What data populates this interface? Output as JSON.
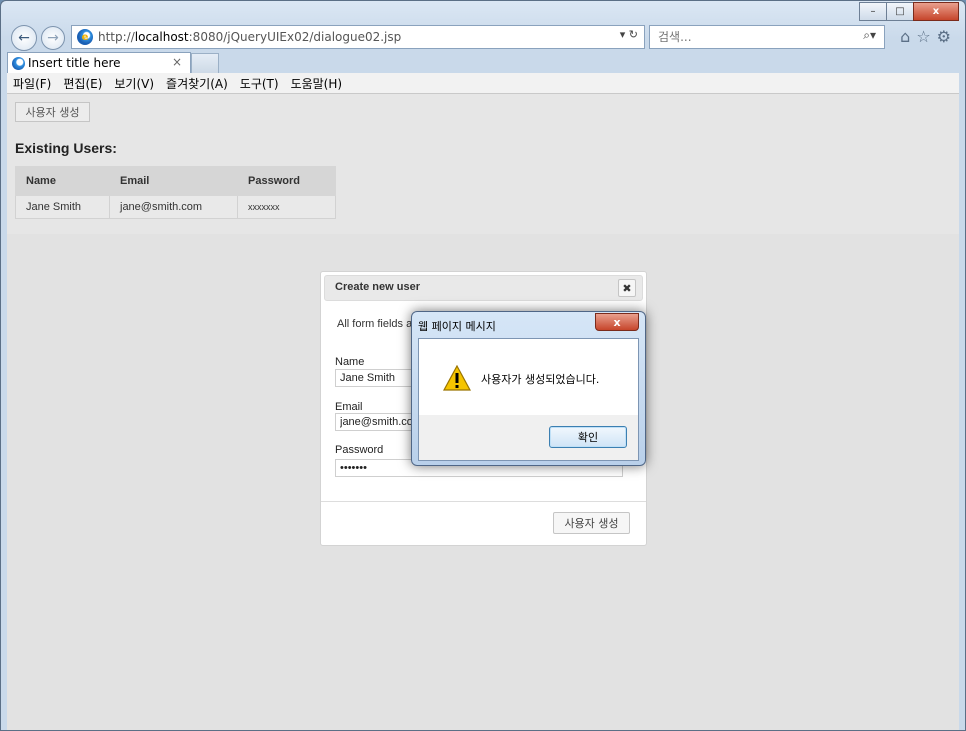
{
  "browser": {
    "url_prefix": "http://",
    "url_host": "localhost",
    "url_rest": ":8080/jQueryUIEx02/dialogue02.jsp",
    "url_tools": "▾ ↻",
    "search_placeholder": "검색...",
    "search_tool": "⌕▾",
    "tab_title": "Insert title here",
    "tab_close": "×",
    "window_min": "–",
    "window_max": "□",
    "window_close": "x"
  },
  "menu": {
    "items": [
      "파일(F)",
      "편집(E)",
      "보기(V)",
      "즐겨찾기(A)",
      "도구(T)",
      "도움말(H)"
    ]
  },
  "page": {
    "create_button": "사용자 생성",
    "existing_title": "Existing Users:",
    "table": {
      "headers": [
        "Name",
        "Email",
        "Password"
      ],
      "rows": [
        [
          "Jane Smith",
          "jane@smith.com",
          "xxxxxxx"
        ]
      ]
    }
  },
  "dialog": {
    "title": "Create new user",
    "close": "✖",
    "description": "All form fields are required.",
    "name_label": "Name",
    "name_value": "Jane Smith",
    "email_label": "Email",
    "email_value": "jane@smith.com",
    "password_label": "Password",
    "password_value": "xxxxxxx",
    "submit": "사용자 생성"
  },
  "alert": {
    "title": "웹 페이지 메시지",
    "close": "x",
    "message": "사용자가 생성되었습니다.",
    "ok": "확인"
  },
  "icons": {
    "back": "back-arrow-icon",
    "forward": "forward-arrow-icon",
    "home": "home-icon",
    "favorites": "star-icon",
    "settings": "gear-icon",
    "warning": "warning-icon"
  }
}
